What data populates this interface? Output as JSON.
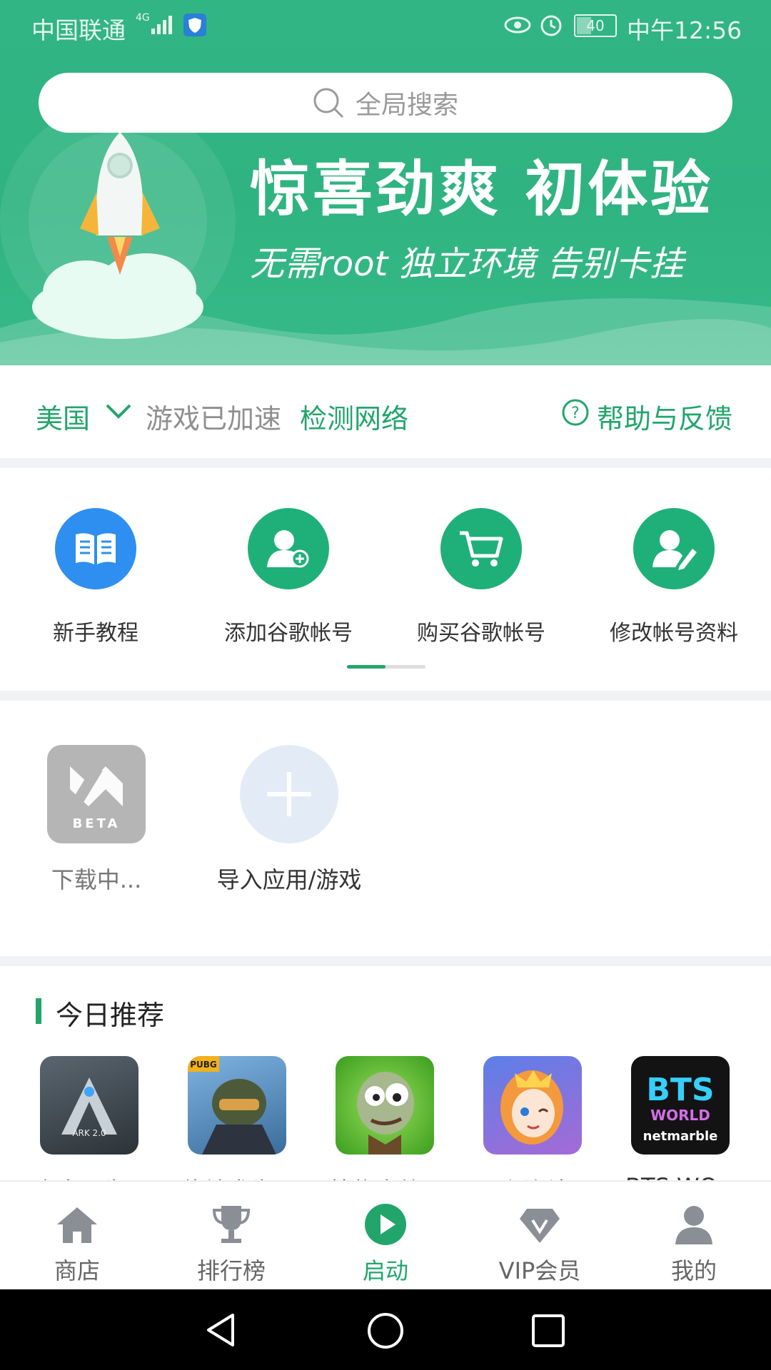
{
  "status_bar": {
    "carrier": "中国联通",
    "network": "4G",
    "battery": "40",
    "time": "中午12:56"
  },
  "search": {
    "placeholder": "全局搜索"
  },
  "banner": {
    "title": "惊喜劲爽  初体验",
    "subtitle": "无需root  独立环境  告别卡挂"
  },
  "region": {
    "country": "美国",
    "status": "游戏已加速",
    "detect": "检测网络",
    "help": "帮助与反馈"
  },
  "quick_actions": [
    {
      "label": "新手教程",
      "icon": "book-icon",
      "color": "#2e8ff0"
    },
    {
      "label": "添加谷歌帐号",
      "icon": "add-user-icon",
      "color": "#1fb07a"
    },
    {
      "label": "购买谷歌帐号",
      "icon": "cart-icon",
      "color": "#1fb07a"
    },
    {
      "label": "修改帐号资料",
      "icon": "edit-user-icon",
      "color": "#1fb07a"
    }
  ],
  "apps": [
    {
      "label": "下载中...",
      "icon": "beta-app-icon",
      "badge": "BETA"
    },
    {
      "label": "导入应用/游戏",
      "icon": "plus-icon"
    }
  ],
  "recommend": {
    "title": "今日推荐",
    "games": [
      {
        "name": "方舟：生...",
        "icon_text": "ARK 2.0"
      },
      {
        "name": "绝地求生...",
        "icon_text": "PUBG"
      },
      {
        "name": "植物大战...",
        "icon_text": ""
      },
      {
        "name": "公主连结...",
        "icon_text": ""
      },
      {
        "name": "BTS WO...",
        "icon_text": "BTS WORLD netmarble"
      }
    ]
  },
  "bottom_nav": [
    {
      "label": "商店",
      "icon": "home-icon",
      "active": false
    },
    {
      "label": "排行榜",
      "icon": "trophy-icon",
      "active": false
    },
    {
      "label": "启动",
      "icon": "play-icon",
      "active": true
    },
    {
      "label": "VIP会员",
      "icon": "diamond-icon",
      "active": false
    },
    {
      "label": "我的",
      "icon": "profile-icon",
      "active": false
    }
  ],
  "colors": {
    "brand": "#22a56b",
    "banner": "#31b585"
  }
}
